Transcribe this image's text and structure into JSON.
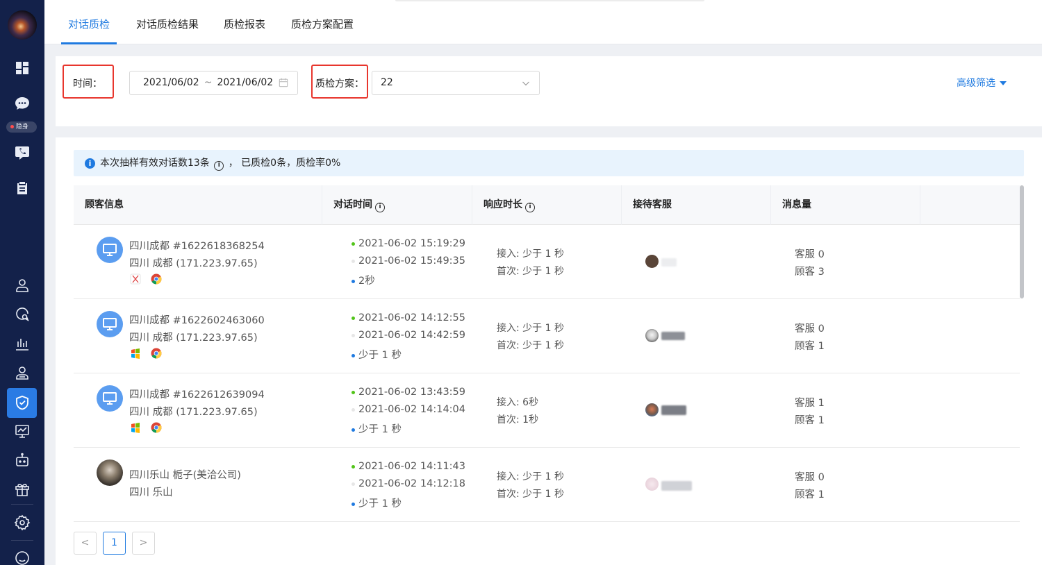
{
  "sidebar": {
    "status_label": "隐身"
  },
  "tabs": [
    {
      "label": "对话质检",
      "active": true
    },
    {
      "label": "对话质检结果",
      "active": false
    },
    {
      "label": "质检报表",
      "active": false
    },
    {
      "label": "质检方案配置",
      "active": false
    }
  ],
  "filter": {
    "time_label": "时间：",
    "date_start": "2021/06/02",
    "date_sep": "~",
    "date_end": "2021/06/02",
    "plan_label": "质检方案：",
    "plan_value": "22",
    "advanced_label": "高级筛选"
  },
  "info": {
    "text_before": "本次抽样有效对话数13条",
    "text_after": "，  已质检0条，质检率0%"
  },
  "table": {
    "headers": [
      "顾客信息",
      "对话时间",
      "响应时长",
      "接待客服",
      "消息量"
    ],
    "rows": [
      {
        "name": "四川成都 #1622618368254",
        "location": "四川 成都 (171.223.97.65)",
        "start": "2021-06-02 15:19:29",
        "end": "2021-06-02 15:49:35",
        "duration": "2秒",
        "resp_accept": "接入: 少于 1 秒",
        "resp_first": "首次: 少于 1 秒",
        "msg_agent": "客服 0",
        "msg_customer": "顾客 3"
      },
      {
        "name": "四川成都 #1622602463060",
        "location": "四川 成都 (171.223.97.65)",
        "start": "2021-06-02 14:12:55",
        "end": "2021-06-02 14:42:59",
        "duration": "少于 1 秒",
        "resp_accept": "接入: 少于 1 秒",
        "resp_first": "首次: 少于 1 秒",
        "msg_agent": "客服 0",
        "msg_customer": "顾客 1"
      },
      {
        "name": "四川成都 #1622612639094",
        "location": "四川 成都 (171.223.97.65)",
        "start": "2021-06-02 13:43:59",
        "end": "2021-06-02 14:14:04",
        "duration": "少于 1 秒",
        "resp_accept": "接入: 6秒",
        "resp_first": "首次: 1秒",
        "msg_agent": "客服 1",
        "msg_customer": "顾客 1"
      },
      {
        "name": "四川乐山 栀子(美洽公司)",
        "location": "四川 乐山",
        "start": "2021-06-02 14:11:43",
        "end": "2021-06-02 14:12:18",
        "duration": "少于 1 秒",
        "resp_accept": "接入: 少于 1 秒",
        "resp_first": "首次: 少于 1 秒",
        "msg_agent": "客服 0",
        "msg_customer": "顾客 1"
      }
    ]
  },
  "pagination": {
    "current": "1",
    "prev": "<",
    "next": ">"
  },
  "colors": {
    "sidebar_bg": "#13214a",
    "accent": "#1f7ae0",
    "highlight_box": "#e8362d"
  }
}
